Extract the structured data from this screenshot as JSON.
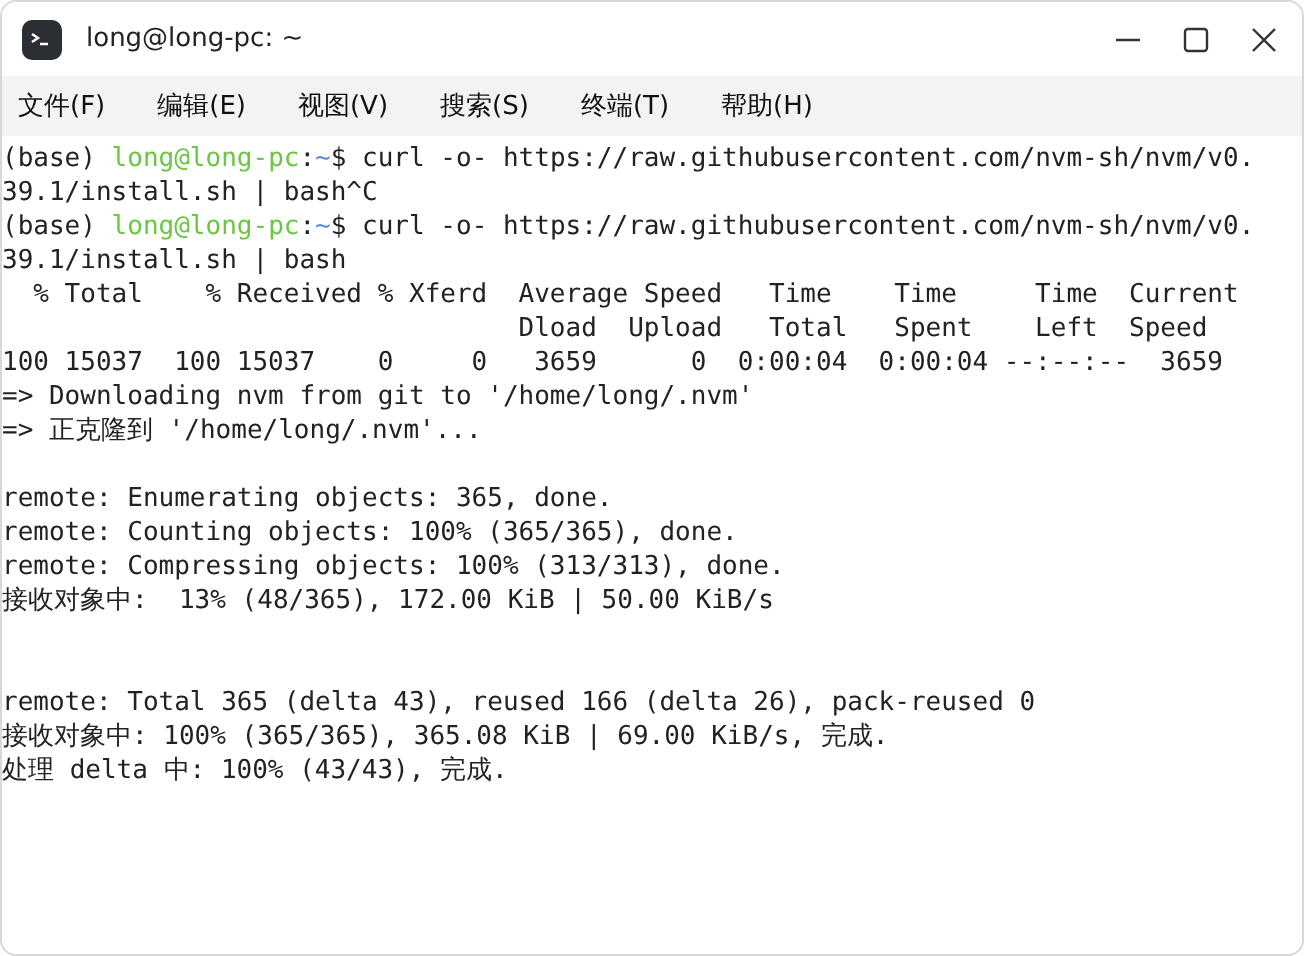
{
  "window": {
    "title": "long@long-pc: ~"
  },
  "menu": [
    {
      "label": "文件(F)"
    },
    {
      "label": "编辑(E)"
    },
    {
      "label": "视图(V)"
    },
    {
      "label": "搜索(S)"
    },
    {
      "label": "终端(T)"
    },
    {
      "label": "帮助(H)"
    }
  ],
  "terminal": {
    "lines": [
      {
        "kind": "text",
        "segments": [
          {
            "kind": "plain",
            "text": "(base) "
          },
          {
            "kind": "user",
            "text": "long@long-pc"
          },
          {
            "kind": "plain",
            "text": ":"
          },
          {
            "kind": "path",
            "text": "~"
          },
          {
            "kind": "plain",
            "text": "$ curl -o- https://raw.githubusercontent.com/nvm-sh/nvm/v0."
          }
        ]
      },
      {
        "kind": "text",
        "segments": [
          {
            "kind": "plain",
            "text": "39.1/install.sh | bash^C"
          }
        ]
      },
      {
        "kind": "text",
        "segments": [
          {
            "kind": "plain",
            "text": "(base) "
          },
          {
            "kind": "user",
            "text": "long@long-pc"
          },
          {
            "kind": "plain",
            "text": ":"
          },
          {
            "kind": "path",
            "text": "~"
          },
          {
            "kind": "plain",
            "text": "$ curl -o- https://raw.githubusercontent.com/nvm-sh/nvm/v0."
          }
        ]
      },
      {
        "kind": "text",
        "segments": [
          {
            "kind": "plain",
            "text": "39.1/install.sh | bash"
          }
        ]
      },
      {
        "kind": "text",
        "segments": [
          {
            "kind": "plain",
            "text": "  % Total    % Received % Xferd  Average Speed   Time    Time     Time  Current"
          }
        ]
      },
      {
        "kind": "text",
        "segments": [
          {
            "kind": "plain",
            "text": "                                 Dload  Upload   Total   Spent    Left  Speed"
          }
        ]
      },
      {
        "kind": "text",
        "segments": [
          {
            "kind": "plain",
            "text": "100 15037  100 15037    0     0   3659      0  0:00:04  0:00:04 --:--:--  3659"
          }
        ]
      },
      {
        "kind": "text",
        "segments": [
          {
            "kind": "plain",
            "text": "=> Downloading nvm from git to '/home/long/.nvm'"
          }
        ]
      },
      {
        "kind": "text",
        "segments": [
          {
            "kind": "plain",
            "text": "=> 正克隆到 '/home/long/.nvm'..."
          }
        ]
      },
      {
        "kind": "blank"
      },
      {
        "kind": "text",
        "segments": [
          {
            "kind": "plain",
            "text": "remote: Enumerating objects: 365, done."
          }
        ]
      },
      {
        "kind": "text",
        "segments": [
          {
            "kind": "plain",
            "text": "remote: Counting objects: 100% (365/365), done."
          }
        ]
      },
      {
        "kind": "text",
        "segments": [
          {
            "kind": "plain",
            "text": "remote: Compressing objects: 100% (313/313), done."
          }
        ]
      },
      {
        "kind": "text",
        "segments": [
          {
            "kind": "plain",
            "text": "接收对象中:  13% (48/365), 172.00 KiB | 50.00 KiB/s"
          }
        ]
      },
      {
        "kind": "blank"
      },
      {
        "kind": "blank"
      },
      {
        "kind": "text",
        "segments": [
          {
            "kind": "plain",
            "text": "remote: Total 365 (delta 43), reused 166 (delta 26), pack-reused 0"
          }
        ]
      },
      {
        "kind": "text",
        "segments": [
          {
            "kind": "plain",
            "text": "接收对象中: 100% (365/365), 365.08 KiB | 69.00 KiB/s, 完成."
          }
        ]
      },
      {
        "kind": "text",
        "segments": [
          {
            "kind": "plain",
            "text": "处理 delta 中: 100% (43/43), 完成."
          }
        ]
      }
    ]
  }
}
